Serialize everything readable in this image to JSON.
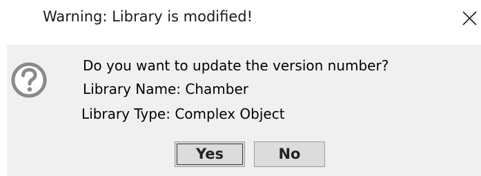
{
  "window": {
    "title": "Warning: Library is modified!",
    "close_icon": "close-icon"
  },
  "message": {
    "icon": "question-icon",
    "question": "Do you want to update the version number?",
    "library_name": "Library Name: Chamber",
    "library_type": "Library Type: Complex Object"
  },
  "buttons": {
    "yes_label": "Yes",
    "no_label": "No"
  },
  "colors": {
    "title_bg": "#ffffff",
    "body_bg": "#f0f0f0",
    "button_bg": "#dcdcdc",
    "icon_gray": "#8a8a8a"
  }
}
